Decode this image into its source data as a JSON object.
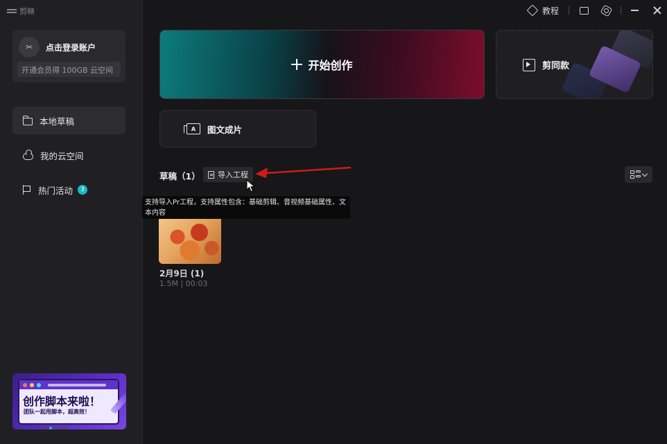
{
  "app": {
    "name": "剪映"
  },
  "account": {
    "avatar_text": "✂",
    "login_label": "点击登录账户",
    "vip_promo": "开通会员得 100GB 云空间"
  },
  "sidebar": {
    "items": [
      {
        "label": "本地草稿",
        "icon": "folder-icon",
        "active": true
      },
      {
        "label": "我的云空间",
        "icon": "cloud-icon",
        "active": false
      },
      {
        "label": "热门活动",
        "icon": "flag-icon",
        "active": false,
        "badge": "3"
      }
    ]
  },
  "promo": {
    "title": "创作脚本来啦！",
    "subtitle": "团队一起用脚本，超高效！"
  },
  "topbar": {
    "tutorial_label": "教程"
  },
  "cards": {
    "start_label": "开始创作",
    "template_label": "剪同款",
    "image_text_label": "图文成片"
  },
  "drafts": {
    "title": "草稿（1）",
    "import_label": "导入工程",
    "tooltip": "支持导入Pr工程，支持属性包含：基础剪辑、音视频基础属性、文本内容",
    "items": [
      {
        "name": "2月9日 (1)",
        "meta": "1.5M | 00:03"
      }
    ]
  },
  "colors": {
    "accent": "#1cb7c8",
    "annotation_arrow": "#d11a1a"
  }
}
